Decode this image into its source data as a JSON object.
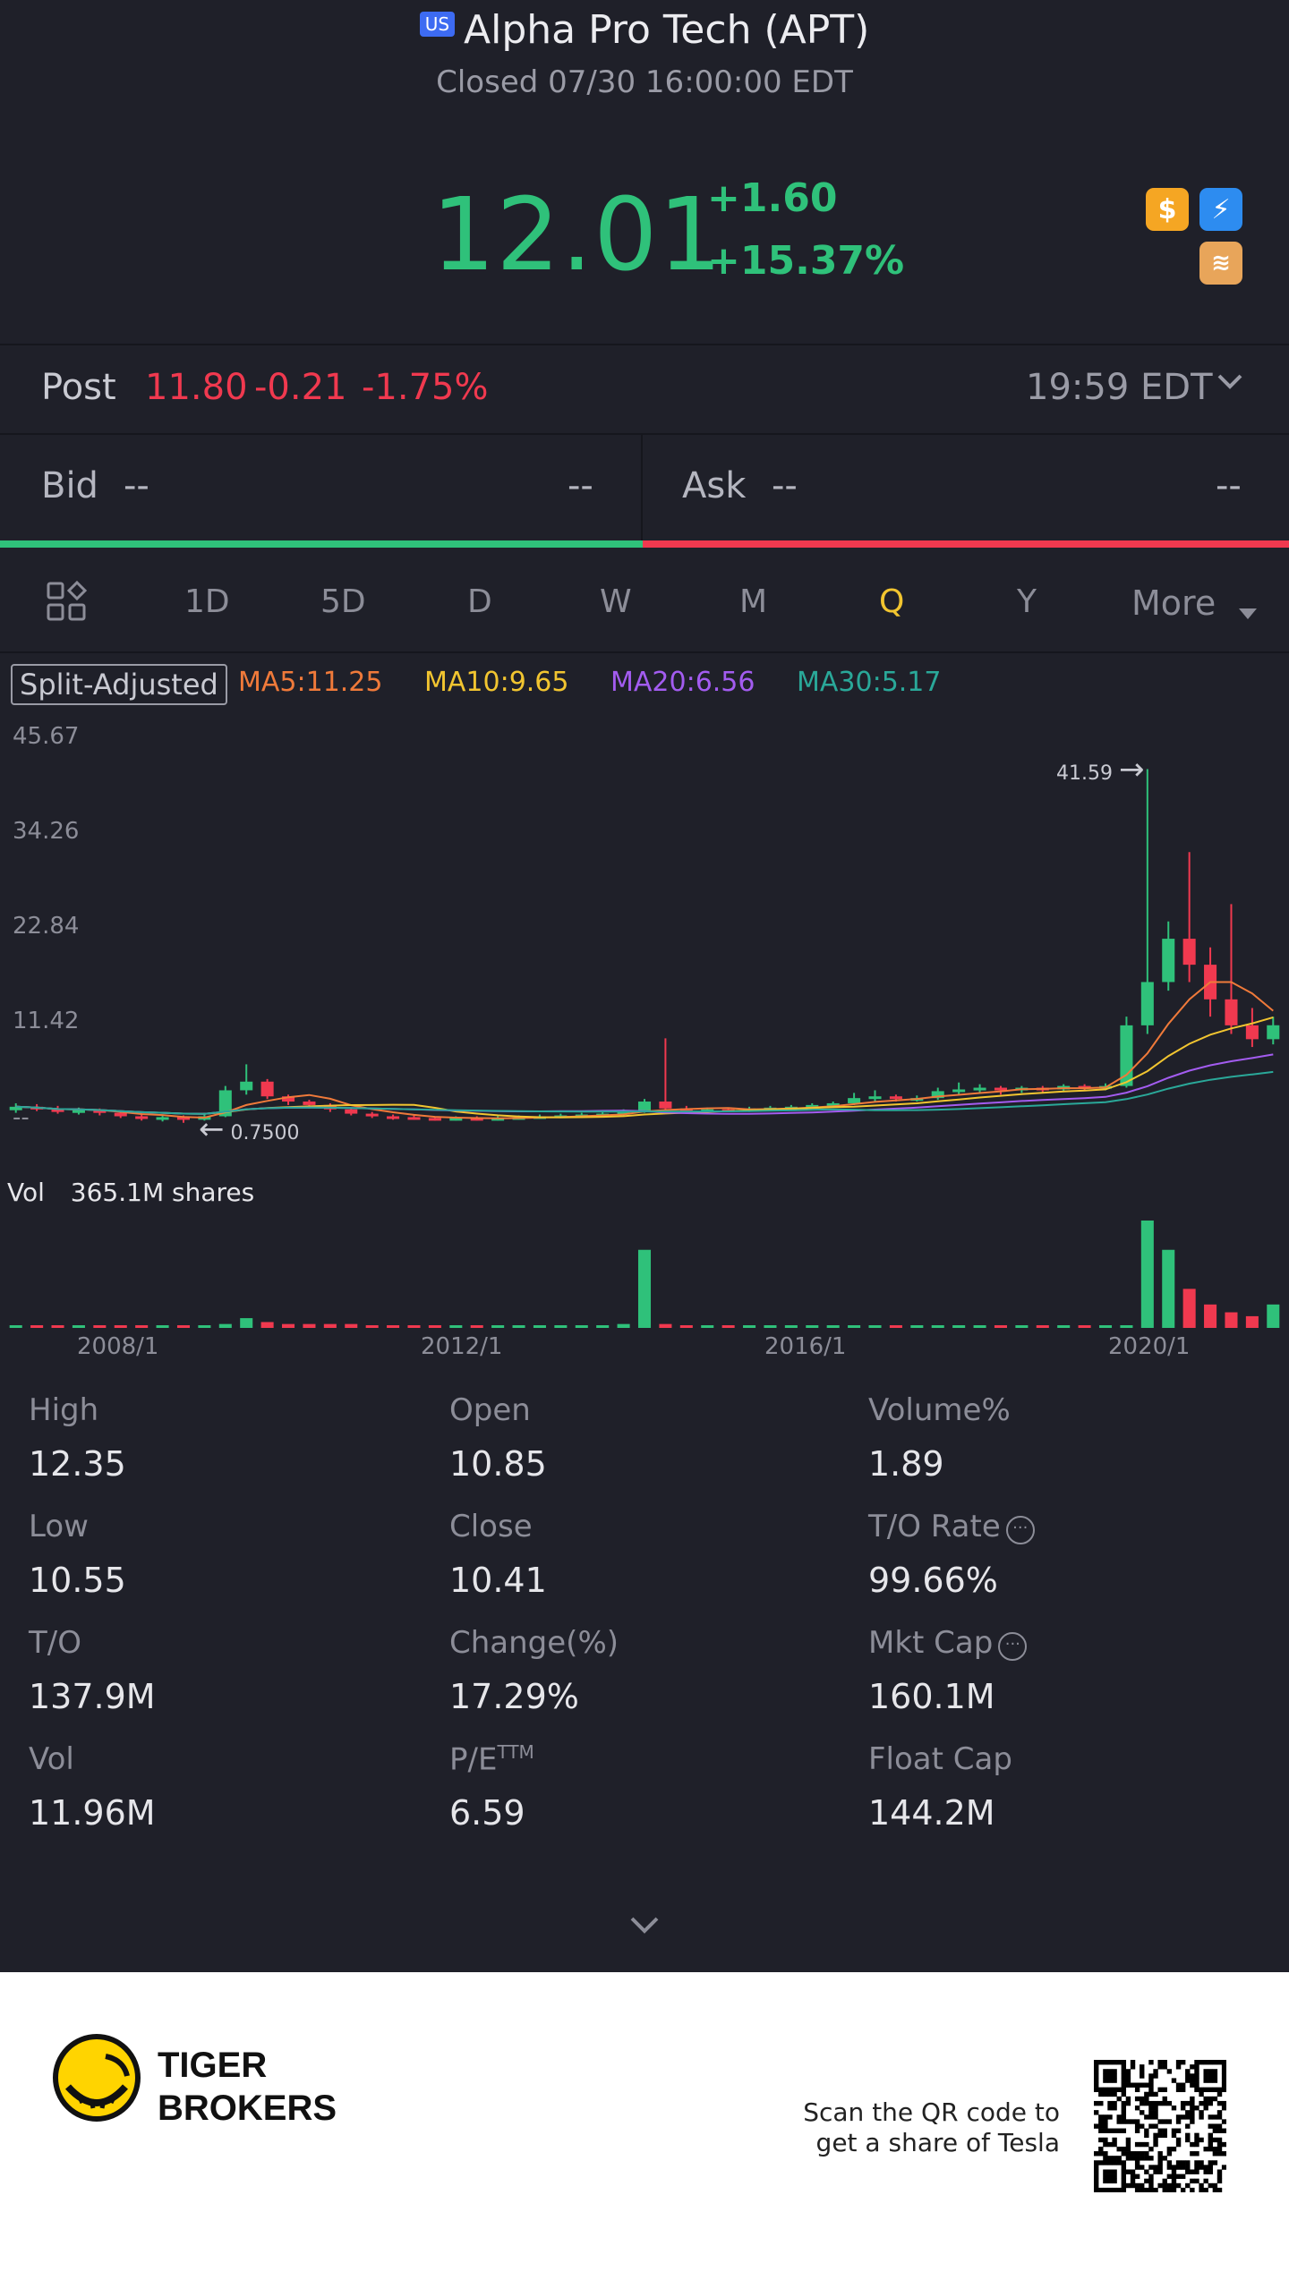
{
  "header": {
    "market_badge": "US",
    "title": "Alpha Pro Tech (APT)",
    "status": "Closed 07/30 16:00:00 EDT"
  },
  "quote": {
    "price": "12.01",
    "change": "+1.60",
    "change_pct": "+15.37%"
  },
  "badges": [
    {
      "name": "dollar-badge-icon",
      "glyph": "$",
      "color": "#f5a623"
    },
    {
      "name": "lightning-badge-icon",
      "glyph": "⚡",
      "color": "#2d8cf0"
    },
    {
      "name": "stack-badge-icon",
      "glyph": "≋",
      "color": "#e8a55a"
    }
  ],
  "post": {
    "label": "Post",
    "price": "11.80",
    "change": "-0.21",
    "change_pct": "-1.75%",
    "time": "19:59 EDT"
  },
  "bid": {
    "label": "Bid",
    "value": "--",
    "size": "--"
  },
  "ask": {
    "label": "Ask",
    "value": "--",
    "size": "--"
  },
  "tabs": {
    "t1d": "1D",
    "t5d": "5D",
    "d": "D",
    "w": "W",
    "m": "M",
    "q": "Q",
    "y": "Y",
    "more": "More"
  },
  "indicators": {
    "split": "Split-Adjusted",
    "ma5": "MA5:11.25",
    "ma10": "MA10:9.65",
    "ma20": "MA20:6.56",
    "ma30": "MA30:5.17"
  },
  "chart": {
    "y_ticks": [
      "45.67",
      "34.26",
      "22.84",
      "11.42",
      "--"
    ],
    "high_marker": "41.59",
    "low_marker": "0.7500",
    "vol_label": "Vol",
    "vol_value": "365.1M shares",
    "x_ticks": [
      "2008/1",
      "2012/1",
      "2016/1",
      "2020/1"
    ],
    "colors": {
      "up": "#2fc17a",
      "down": "#f0394f",
      "ma5": "#f07a3a",
      "ma10": "#f2c530",
      "ma20": "#a35cf0",
      "ma30": "#2aa899"
    }
  },
  "chart_data": {
    "type": "candlestick",
    "x_ticks": [
      "2008/1",
      "2012/1",
      "2016/1",
      "2020/1"
    ],
    "y_ticks": [
      45.67,
      34.26,
      22.84,
      11.42
    ],
    "ylim": [
      0,
      45.67
    ],
    "annotations": [
      {
        "label": "41.59",
        "kind": "high"
      },
      {
        "label": "0.7500",
        "kind": "low"
      }
    ],
    "series": [
      {
        "name": "MA5",
        "last": 11.25
      },
      {
        "name": "MA10",
        "last": 9.65
      },
      {
        "name": "MA20",
        "last": 6.56
      },
      {
        "name": "MA30",
        "last": 5.17
      }
    ],
    "candles": [
      {
        "o": 2.2,
        "c": 2.6,
        "h": 3.0,
        "l": 1.9
      },
      {
        "o": 2.6,
        "c": 2.4,
        "h": 2.9,
        "l": 2.1
      },
      {
        "o": 2.4,
        "c": 2.0,
        "h": 2.7,
        "l": 1.8
      },
      {
        "o": 2.0,
        "c": 2.2,
        "h": 2.5,
        "l": 1.7
      },
      {
        "o": 2.2,
        "c": 1.9,
        "h": 2.4,
        "l": 1.6
      },
      {
        "o": 1.9,
        "c": 1.5,
        "h": 2.1,
        "l": 1.3
      },
      {
        "o": 1.5,
        "c": 1.2,
        "h": 1.8,
        "l": 1.0
      },
      {
        "o": 1.2,
        "c": 1.4,
        "h": 1.7,
        "l": 0.9
      },
      {
        "o": 1.4,
        "c": 1.1,
        "h": 1.6,
        "l": 0.75
      },
      {
        "o": 1.1,
        "c": 1.5,
        "h": 1.9,
        "l": 1.0
      },
      {
        "o": 1.5,
        "c": 4.5,
        "h": 5.0,
        "l": 1.4
      },
      {
        "o": 4.5,
        "c": 5.5,
        "h": 7.5,
        "l": 4.0
      },
      {
        "o": 5.5,
        "c": 3.8,
        "h": 5.8,
        "l": 3.5
      },
      {
        "o": 3.8,
        "c": 3.2,
        "h": 4.0,
        "l": 2.8
      },
      {
        "o": 3.2,
        "c": 2.8,
        "h": 3.4,
        "l": 2.4
      },
      {
        "o": 2.8,
        "c": 2.3,
        "h": 3.0,
        "l": 2.0
      },
      {
        "o": 2.3,
        "c": 1.8,
        "h": 2.5,
        "l": 1.6
      },
      {
        "o": 1.8,
        "c": 1.5,
        "h": 2.0,
        "l": 1.3
      },
      {
        "o": 1.5,
        "c": 1.4,
        "h": 1.7,
        "l": 1.1
      },
      {
        "o": 1.4,
        "c": 1.3,
        "h": 1.6,
        "l": 1.1
      },
      {
        "o": 1.3,
        "c": 1.2,
        "h": 1.5,
        "l": 1.0
      },
      {
        "o": 1.2,
        "c": 1.3,
        "h": 1.5,
        "l": 1.0
      },
      {
        "o": 1.3,
        "c": 1.25,
        "h": 1.5,
        "l": 1.0
      },
      {
        "o": 1.25,
        "c": 1.3,
        "h": 1.5,
        "l": 1.0
      },
      {
        "o": 1.3,
        "c": 1.4,
        "h": 1.6,
        "l": 1.1
      },
      {
        "o": 1.4,
        "c": 1.5,
        "h": 1.7,
        "l": 1.2
      },
      {
        "o": 1.5,
        "c": 1.6,
        "h": 1.8,
        "l": 1.3
      },
      {
        "o": 1.6,
        "c": 1.7,
        "h": 1.9,
        "l": 1.4
      },
      {
        "o": 1.7,
        "c": 1.8,
        "h": 2.0,
        "l": 1.5
      },
      {
        "o": 1.8,
        "c": 2.0,
        "h": 2.3,
        "l": 1.6
      },
      {
        "o": 2.0,
        "c": 3.2,
        "h": 3.5,
        "l": 1.9
      },
      {
        "o": 3.2,
        "c": 2.4,
        "h": 10.5,
        "l": 2.0
      },
      {
        "o": 2.4,
        "c": 2.2,
        "h": 2.7,
        "l": 2.0
      },
      {
        "o": 2.2,
        "c": 2.3,
        "h": 2.5,
        "l": 2.0
      },
      {
        "o": 2.3,
        "c": 2.2,
        "h": 2.5,
        "l": 2.0
      },
      {
        "o": 2.2,
        "c": 2.4,
        "h": 2.6,
        "l": 2.0
      },
      {
        "o": 2.4,
        "c": 2.5,
        "h": 2.7,
        "l": 2.2
      },
      {
        "o": 2.5,
        "c": 2.6,
        "h": 2.8,
        "l": 2.3
      },
      {
        "o": 2.6,
        "c": 2.8,
        "h": 3.0,
        "l": 2.4
      },
      {
        "o": 2.8,
        "c": 3.0,
        "h": 3.2,
        "l": 2.6
      },
      {
        "o": 3.0,
        "c": 3.6,
        "h": 4.2,
        "l": 2.8
      },
      {
        "o": 3.6,
        "c": 3.8,
        "h": 4.5,
        "l": 3.2
      },
      {
        "o": 3.8,
        "c": 3.5,
        "h": 4.0,
        "l": 3.2
      },
      {
        "o": 3.5,
        "c": 3.6,
        "h": 3.9,
        "l": 3.2
      },
      {
        "o": 3.6,
        "c": 4.4,
        "h": 4.8,
        "l": 3.4
      },
      {
        "o": 4.4,
        "c": 4.6,
        "h": 5.4,
        "l": 4.0
      },
      {
        "o": 4.6,
        "c": 4.8,
        "h": 5.2,
        "l": 4.2
      },
      {
        "o": 4.8,
        "c": 4.5,
        "h": 5.0,
        "l": 4.0
      },
      {
        "o": 4.5,
        "c": 4.8,
        "h": 5.0,
        "l": 4.2
      },
      {
        "o": 4.8,
        "c": 4.6,
        "h": 5.0,
        "l": 4.2
      },
      {
        "o": 4.6,
        "c": 5.0,
        "h": 5.2,
        "l": 4.3
      },
      {
        "o": 5.0,
        "c": 4.8,
        "h": 5.2,
        "l": 4.4
      },
      {
        "o": 4.8,
        "c": 5.0,
        "h": 5.3,
        "l": 4.5
      },
      {
        "o": 5.0,
        "c": 12.0,
        "h": 13.0,
        "l": 4.8
      },
      {
        "o": 12.0,
        "c": 17.0,
        "h": 41.59,
        "l": 11.0
      },
      {
        "o": 17.0,
        "c": 22.0,
        "h": 24.0,
        "l": 16.0
      },
      {
        "o": 22.0,
        "c": 19.0,
        "h": 32.0,
        "l": 17.0
      },
      {
        "o": 19.0,
        "c": 15.0,
        "h": 21.0,
        "l": 13.0
      },
      {
        "o": 15.0,
        "c": 12.0,
        "h": 26.0,
        "l": 11.0
      },
      {
        "o": 12.0,
        "c": 10.4,
        "h": 14.0,
        "l": 9.5
      },
      {
        "o": 10.4,
        "c": 12.01,
        "h": 13.0,
        "l": 9.8
      }
    ],
    "volume": [
      1,
      1,
      1,
      1,
      1,
      1,
      1,
      1,
      1,
      1,
      2,
      5,
      3,
      2,
      2,
      2,
      2,
      1,
      1,
      1,
      1,
      1,
      1,
      1,
      1,
      1,
      1,
      1,
      1,
      2,
      40,
      2,
      1,
      1,
      1,
      1,
      1,
      1,
      1,
      1,
      1,
      1,
      1,
      1,
      1,
      1,
      1,
      1,
      1,
      1,
      1,
      1,
      1,
      1,
      55,
      40,
      20,
      12,
      8,
      6,
      12
    ]
  },
  "stats": [
    {
      "label": "High",
      "value": "12.35"
    },
    {
      "label": "Open",
      "value": "10.85"
    },
    {
      "label": "Volume%",
      "value": "1.89"
    },
    {
      "label": "Low",
      "value": "10.55"
    },
    {
      "label": "Close",
      "value": "10.41"
    },
    {
      "label": "T/O Rate",
      "value": "99.66%"
    },
    {
      "label": "T/O",
      "value": "137.9M"
    },
    {
      "label": "Change(%)",
      "value": "17.29%"
    },
    {
      "label": "Mkt Cap",
      "value": "160.1M"
    },
    {
      "label": "Vol",
      "value": "11.96M"
    },
    {
      "label": "P/E",
      "label_sup": "TTM",
      "value": "6.59"
    },
    {
      "label": "Float Cap",
      "value": "144.2M"
    }
  ],
  "footer": {
    "brand_line1": "TIGER",
    "brand_line2": "BROKERS",
    "scan_line1": "Scan the QR code to",
    "scan_line2": "get a share of Tesla"
  }
}
